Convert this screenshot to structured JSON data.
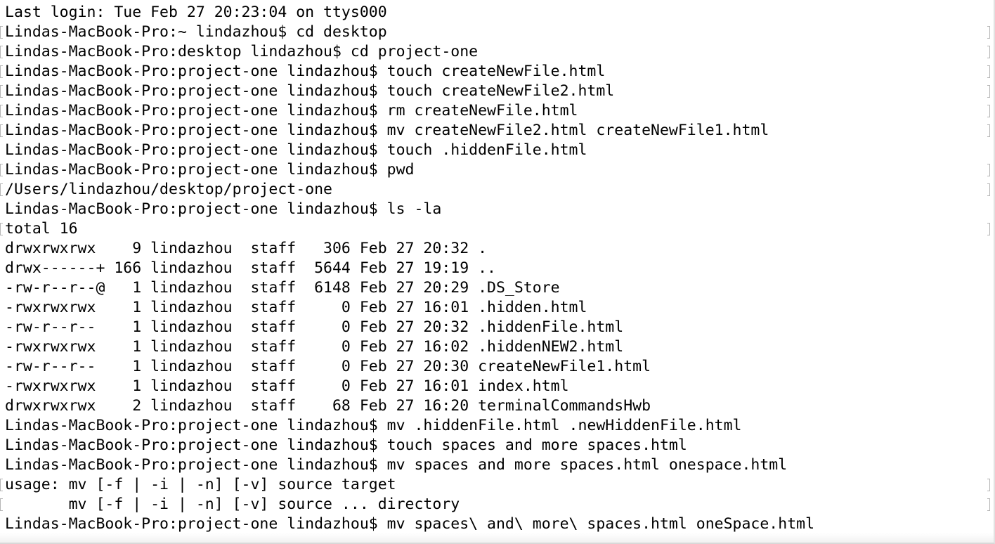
{
  "terminal": {
    "lines": [
      {
        "text": "Last login: Tue Feb 27 20:23:04 on ttys000",
        "mark": false,
        "rmark": false
      },
      {
        "text": "Lindas-MacBook-Pro:~ lindazhou$ cd desktop",
        "mark": true,
        "rmark": true
      },
      {
        "text": "Lindas-MacBook-Pro:desktop lindazhou$ cd project-one",
        "mark": true,
        "rmark": true
      },
      {
        "text": "Lindas-MacBook-Pro:project-one lindazhou$ touch createNewFile.html",
        "mark": true,
        "rmark": true
      },
      {
        "text": "Lindas-MacBook-Pro:project-one lindazhou$ touch createNewFile2.html",
        "mark": true,
        "rmark": true
      },
      {
        "text": "Lindas-MacBook-Pro:project-one lindazhou$ rm createNewFile.html",
        "mark": true,
        "rmark": true
      },
      {
        "text": "Lindas-MacBook-Pro:project-one lindazhou$ mv createNewFile2.html createNewFile1.html",
        "mark": true,
        "rmark": true
      },
      {
        "text": "Lindas-MacBook-Pro:project-one lindazhou$ touch .hiddenFile.html",
        "mark": false,
        "rmark": false
      },
      {
        "text": "Lindas-MacBook-Pro:project-one lindazhou$ pwd",
        "mark": true,
        "rmark": true
      },
      {
        "text": "/Users/lindazhou/desktop/project-one",
        "mark": true,
        "rmark": true
      },
      {
        "text": "Lindas-MacBook-Pro:project-one lindazhou$ ls -la",
        "mark": false,
        "rmark": false
      },
      {
        "text": "total 16",
        "mark": true,
        "rmark": true
      },
      {
        "text": "drwxrwxrwx    9 lindazhou  staff   306 Feb 27 20:32 .",
        "mark": false,
        "rmark": false
      },
      {
        "text": "drwx------+ 166 lindazhou  staff  5644 Feb 27 19:19 ..",
        "mark": false,
        "rmark": false
      },
      {
        "text": "-rw-r--r--@   1 lindazhou  staff  6148 Feb 27 20:29 .DS_Store",
        "mark": false,
        "rmark": false
      },
      {
        "text": "-rwxrwxrwx    1 lindazhou  staff     0 Feb 27 16:01 .hidden.html",
        "mark": false,
        "rmark": false
      },
      {
        "text": "-rw-r--r--    1 lindazhou  staff     0 Feb 27 20:32 .hiddenFile.html",
        "mark": false,
        "rmark": false
      },
      {
        "text": "-rwxrwxrwx    1 lindazhou  staff     0 Feb 27 16:02 .hiddenNEW2.html",
        "mark": false,
        "rmark": false
      },
      {
        "text": "-rw-r--r--    1 lindazhou  staff     0 Feb 27 20:30 createNewFile1.html",
        "mark": false,
        "rmark": false
      },
      {
        "text": "-rwxrwxrwx    1 lindazhou  staff     0 Feb 27 16:01 index.html",
        "mark": false,
        "rmark": false
      },
      {
        "text": "drwxrwxrwx    2 lindazhou  staff    68 Feb 27 16:20 terminalCommandsHwb",
        "mark": false,
        "rmark": false
      },
      {
        "text": "Lindas-MacBook-Pro:project-one lindazhou$ mv .hiddenFile.html .newHiddenFile.html",
        "mark": false,
        "rmark": false
      },
      {
        "text": "Lindas-MacBook-Pro:project-one lindazhou$ touch spaces and more spaces.html",
        "mark": false,
        "rmark": false
      },
      {
        "text": "Lindas-MacBook-Pro:project-one lindazhou$ mv spaces and more spaces.html onespace.html",
        "mark": false,
        "rmark": false
      },
      {
        "text": "usage: mv [-f | -i | -n] [-v] source target",
        "mark": true,
        "rmark": true
      },
      {
        "text": "       mv [-f | -i | -n] [-v] source ... directory",
        "mark": true,
        "rmark": true
      },
      {
        "text": "Lindas-MacBook-Pro:project-one lindazhou$ mv spaces\\ and\\ more\\ spaces.html oneSpace.html",
        "mark": false,
        "rmark": false
      }
    ]
  }
}
